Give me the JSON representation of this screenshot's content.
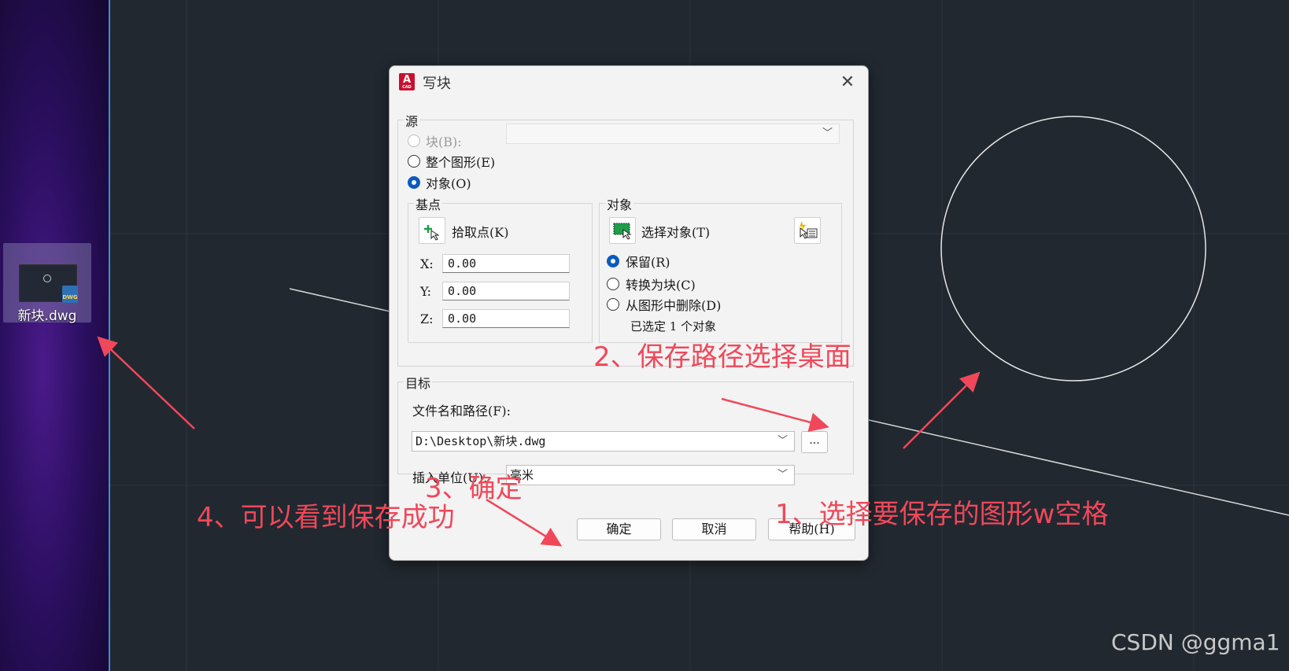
{
  "desktop": {
    "icon_label": "新块.dwg",
    "badge": "DWG"
  },
  "dialog": {
    "title": "写块",
    "app_icon": "A",
    "app_icon_sub": "CAD",
    "close_glyph": "✕",
    "source": {
      "label": "源",
      "block_label": "块(B):",
      "whole_label": "整个图形(E)",
      "objects_label": "对象(O)",
      "selected": "objects"
    },
    "basepoint": {
      "label": "基点",
      "pick_label": "拾取点(K)",
      "x_label": "X:",
      "x_value": "0.00",
      "y_label": "Y:",
      "y_value": "0.00",
      "z_label": "Z:",
      "z_value": "0.00"
    },
    "objects": {
      "label": "对象",
      "select_label": "选择对象(T)",
      "retain_label": "保留(R)",
      "convert_label": "转换为块(C)",
      "delete_label": "从图形中删除(D)",
      "status": "已选定 1 个对象"
    },
    "target": {
      "label": "目标",
      "file_label": "文件名和路径(F):",
      "file_value": "D:\\Desktop\\新块.dwg",
      "browse_label": "...",
      "units_label": "插入单位(U):",
      "units_value": "毫米"
    },
    "buttons": {
      "ok": "确定",
      "cancel": "取消",
      "help": "帮助(H)"
    }
  },
  "annotations": {
    "step1": "1、选择要保存的图形w空格",
    "step2": "2、保存路径选择桌面",
    "step3": "3、确定",
    "step4": "4、可以看到保存成功",
    "color": "#f0485a"
  },
  "watermark": "CSDN @ggma1",
  "colors": {
    "canvas_bg": "#212830",
    "grid": "#2c343e",
    "accent_radio": "#0a5bbf",
    "desktop_edge": "#3b8de0"
  }
}
